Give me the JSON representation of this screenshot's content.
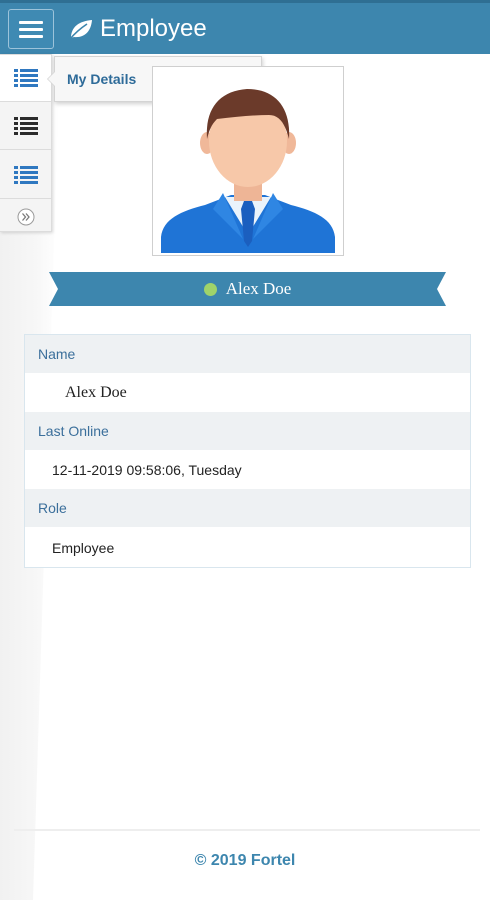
{
  "app": {
    "title": "Employee",
    "icon": "leaf-icon",
    "brand_color": "#3d86ae"
  },
  "header": {
    "menu_icon": "hamburger-icon"
  },
  "side_toolbar": {
    "items": [
      {
        "icon": "list-icon",
        "active": true
      },
      {
        "icon": "list-icon",
        "active": false
      },
      {
        "icon": "list-icon",
        "active": false
      }
    ],
    "expand_icon": "double-chevron-right-icon"
  },
  "popover": {
    "label": "My Details"
  },
  "profile": {
    "avatar_icon": "user-avatar-icon",
    "name": "Alex Doe",
    "status": "online",
    "status_color": "#9fd36a"
  },
  "details": {
    "rows": [
      {
        "label": "Name",
        "value": "Alex Doe"
      },
      {
        "label": "Last Online",
        "value": "12-11-2019 09:58:06, Tuesday"
      },
      {
        "label": "Role",
        "value": "Employee"
      }
    ]
  },
  "footer": {
    "copyright": "© 2019 Fortel"
  }
}
